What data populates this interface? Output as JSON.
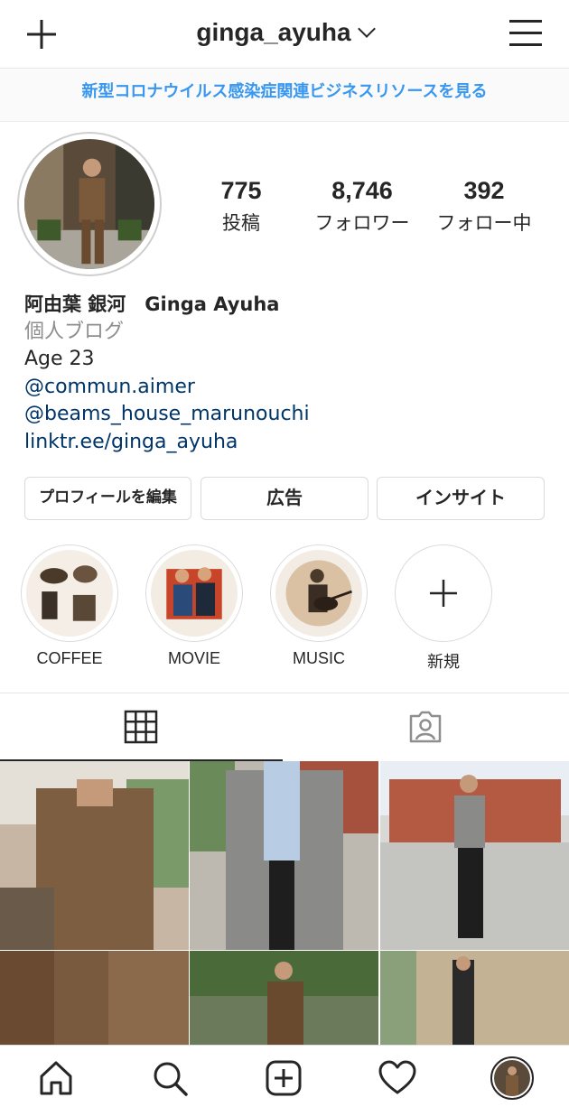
{
  "header": {
    "username": "ginga_ayuha",
    "new_post_icon": "plus-icon",
    "menu_icon": "hamburger-icon"
  },
  "banner": {
    "text": "新型コロナウイルス感染症関連ビジネスリソースを見る"
  },
  "stats": [
    {
      "num": "775",
      "label": "投稿"
    },
    {
      "num": "8,746",
      "label": "フォロワー"
    },
    {
      "num": "392",
      "label": "フォロー中"
    }
  ],
  "bio": {
    "name": "阿由葉 銀河　Ginga Ayuha",
    "category": "個人ブログ",
    "line1": "Age 23",
    "link1": "@commun.aimer",
    "link2": "@beams_house_marunouchi",
    "link3": "linktr.ee/ginga_ayuha"
  },
  "buttons": {
    "edit": "プロフィールを編集",
    "ads": "広告",
    "insights": "インサイト"
  },
  "highlights": [
    {
      "label": "COFFEE"
    },
    {
      "label": "MOVIE"
    },
    {
      "label": "MUSIC"
    },
    {
      "label": "新規"
    }
  ],
  "tabs": {
    "grid_icon": "grid-icon",
    "tagged_icon": "tagged-person-icon"
  },
  "nav": [
    "home-icon",
    "search-icon",
    "new-post-icon",
    "heart-icon",
    "profile-avatar"
  ],
  "colors": {
    "link": "#3897f0",
    "bio_link": "#003569",
    "border": "#dbdbdb"
  }
}
